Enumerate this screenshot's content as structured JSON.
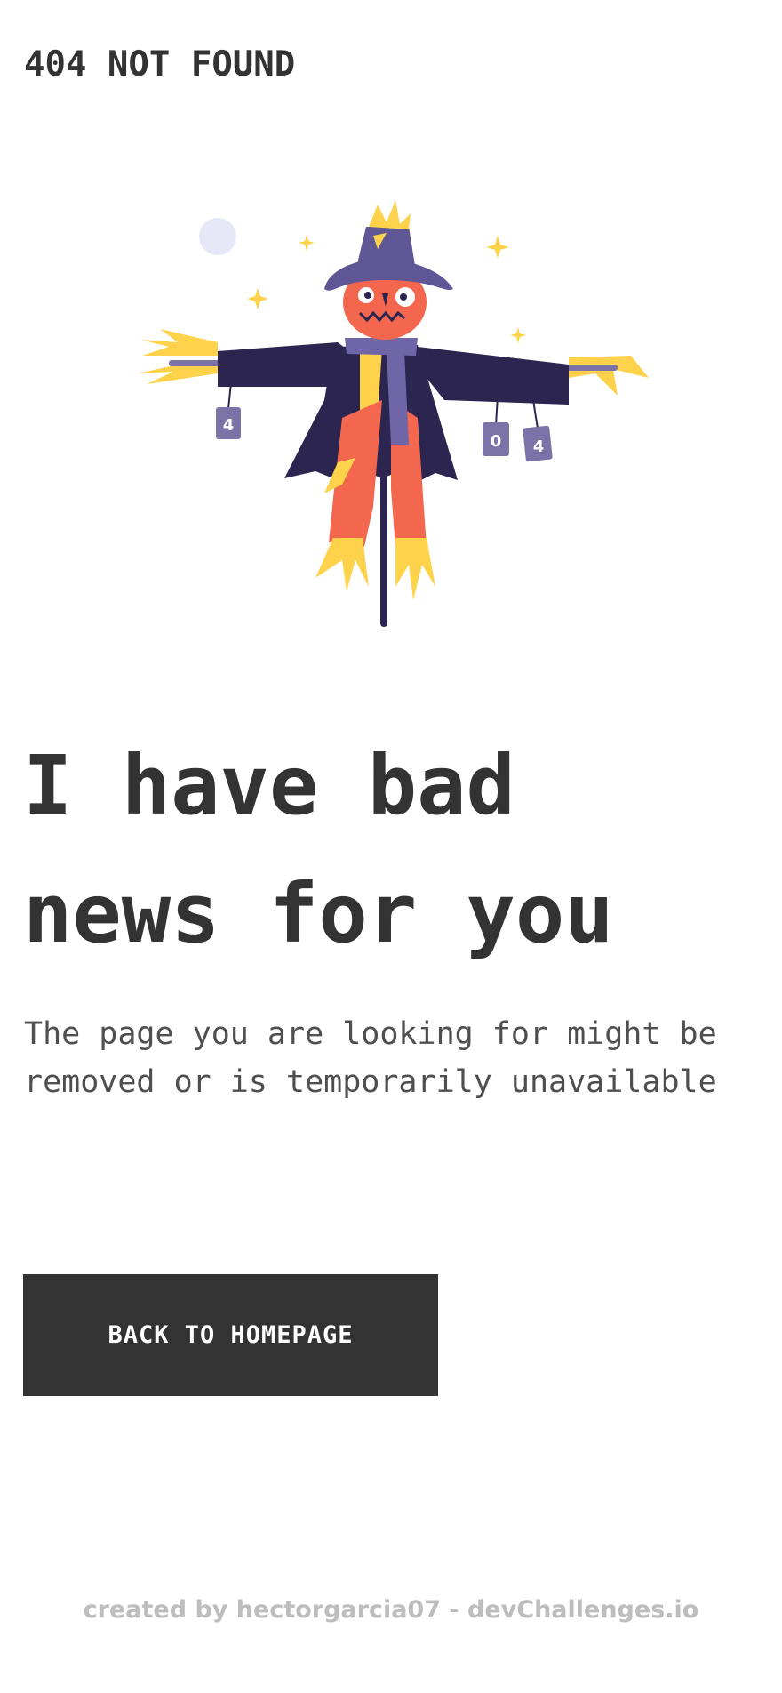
{
  "header": {
    "brand": "404 NOT FOUND"
  },
  "illustration": {
    "name": "scarecrow",
    "can_labels": [
      "4",
      "0",
      "4"
    ],
    "colors": {
      "coat": "#2b2550",
      "hat": "#5e5695",
      "face": "#f3674f",
      "straw": "#ffd24b",
      "scarf": "#6f66a8",
      "pants": "#f3674f",
      "moon": "#e6e8f8",
      "can": "#7b73a8"
    }
  },
  "main": {
    "headline_line1": "I have bad",
    "headline_line2": "news for you",
    "description": "The page you are looking for might be removed or is temporarily unavailable",
    "cta_label": "BACK TO HOMEPAGE"
  },
  "footer": {
    "credit": "created by hectorgarcia07 - devChallenges.io"
  },
  "colors": {
    "text": "#333333",
    "button_bg": "#333333",
    "button_text": "#ffffff",
    "footer_text": "#bdbdbd"
  }
}
